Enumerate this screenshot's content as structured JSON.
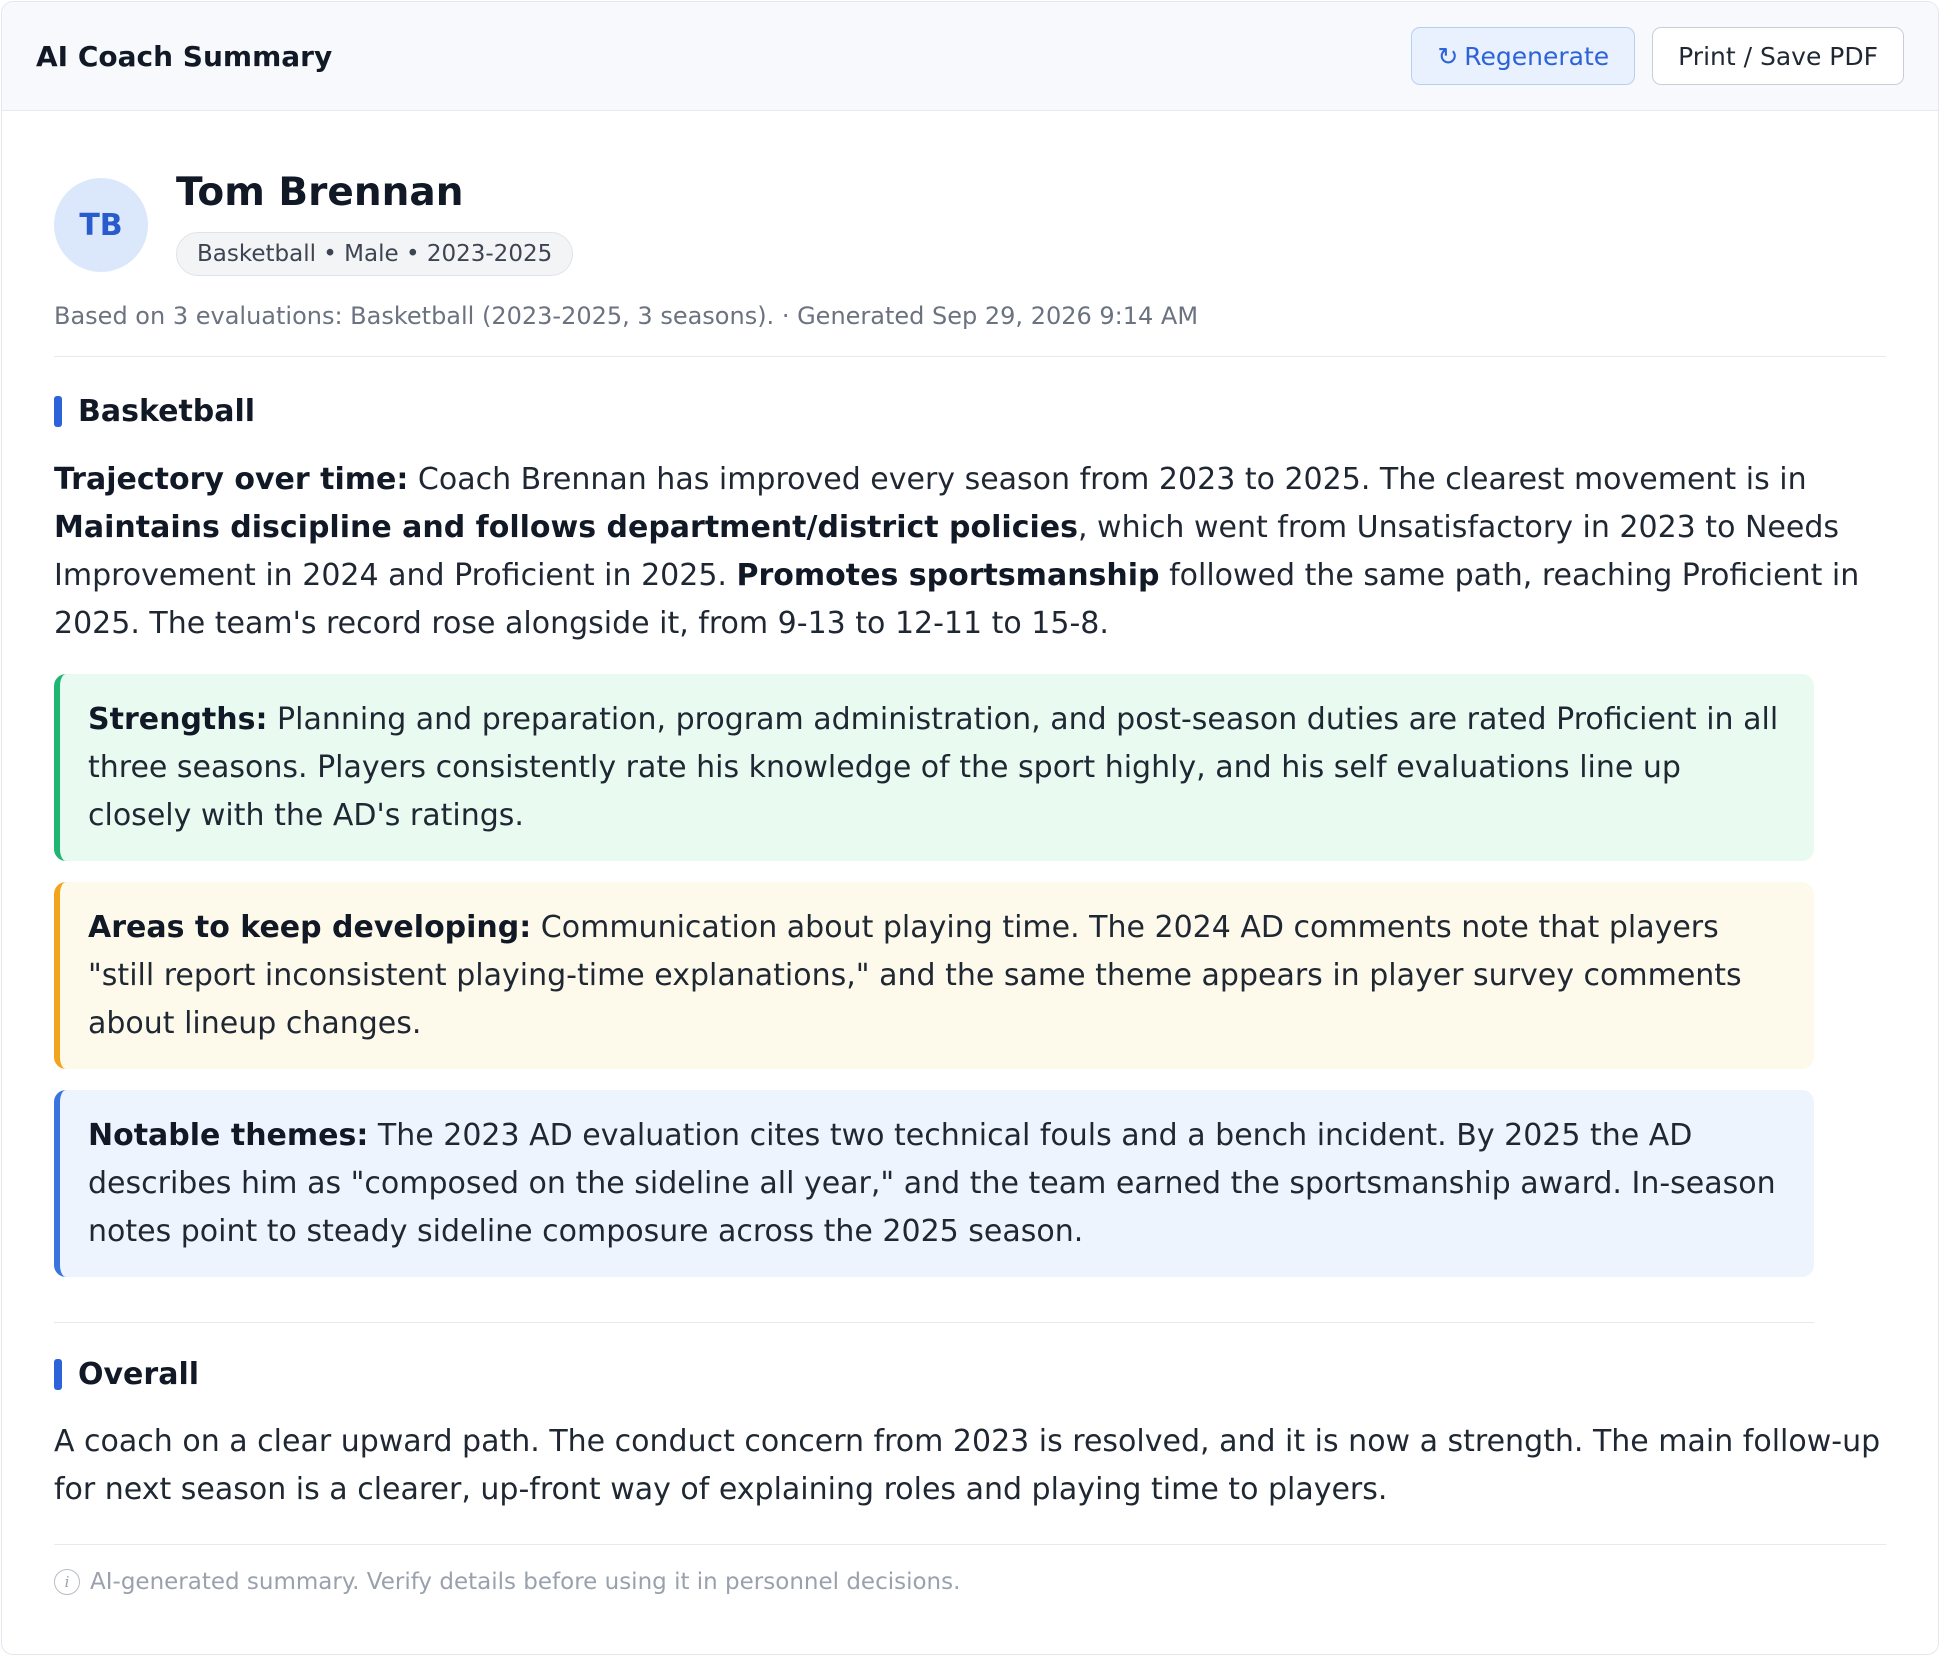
{
  "header": {
    "title": "AI Coach Summary",
    "regenerate_icon": "↻",
    "regenerate_label": "Regenerate",
    "print_label": "Print / Save PDF"
  },
  "coach": {
    "initials": "TB",
    "name": "Tom Brennan",
    "tags": "Basketball • Male • 2023-2025"
  },
  "basis_text": "Based on 3 evaluations: Basketball (2023-2025, 3 seasons). · Generated Sep 29, 2026 9:14 AM",
  "sections": {
    "sport": {
      "title": "Basketball",
      "trajectory": {
        "label": "Trajectory over time:",
        "text_1": " Coach Brennan has improved every season from 2023 to 2025. The clearest movement is in ",
        "bold_1": "Maintains discipline and follows department/district policies",
        "text_2": ", which went from Unsatisfactory in 2023 to Needs Improvement in 2024 and Proficient in 2025. ",
        "bold_2": "Promotes sportsmanship",
        "text_3": " followed the same path, reaching Proficient in 2025. The team's record rose alongside it, from 9-13 to 12-11 to 15-8."
      },
      "strengths": {
        "label": "Strengths:",
        "text": " Planning and preparation, program administration, and post-season duties are rated Proficient in all three seasons. Players consistently rate his knowledge of the sport highly, and his self evaluations line up closely with the AD's ratings."
      },
      "develop": {
        "label": "Areas to keep developing:",
        "text": " Communication about playing time. The 2024 AD comments note that players \"still report inconsistent playing-time explanations,\" and the same theme appears in player survey comments about lineup changes."
      },
      "themes": {
        "label": "Notable themes:",
        "text": " The 2023 AD evaluation cites two technical fouls and a bench incident. By 2025 the AD describes him as \"composed on the sideline all year,\" and the team earned the sportsmanship award. In-season notes point to steady sideline composure across the 2025 season."
      }
    },
    "overall": {
      "title": "Overall",
      "text": "A coach on a clear upward path. The conduct concern from 2023 is resolved, and it is now a strength. The main follow-up for next season is a clearer, up-front way of explaining roles and playing time to players."
    }
  },
  "footer": {
    "icon": "i",
    "note": "AI-generated summary. Verify details before using it in personnel decisions."
  },
  "colors": {
    "accent": "#2d63d8",
    "strengths_border": "#1fb673",
    "develop_border": "#f2a51c",
    "themes_border": "#3a74de"
  }
}
